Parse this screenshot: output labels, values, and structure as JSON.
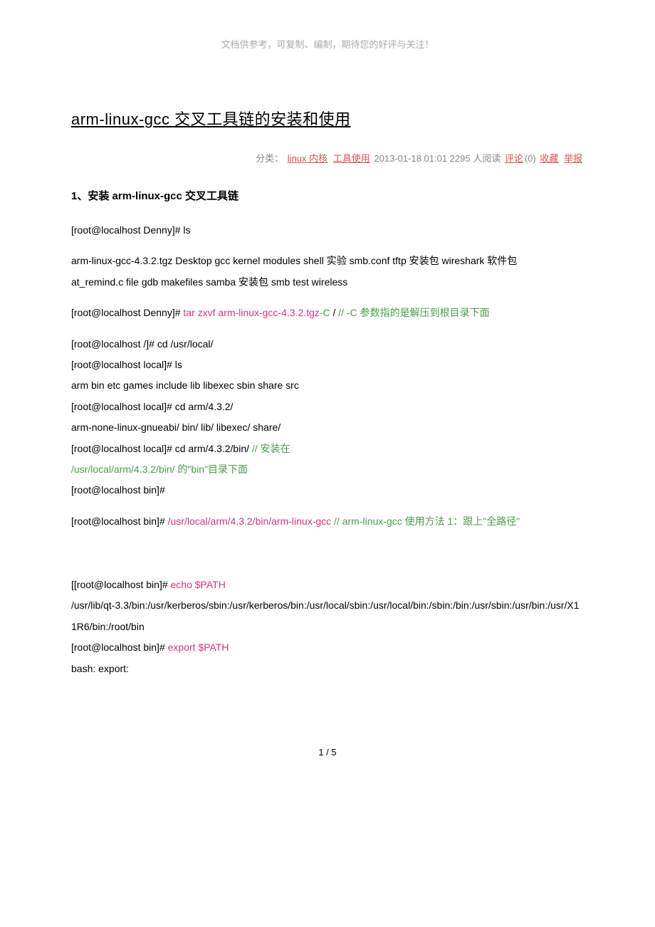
{
  "header_note": "文档供参考，可复制、编制，期待您的好评与关注！",
  "title": "arm-linux-gcc 交叉工具链的安装和使用",
  "meta": {
    "category_label": "分类：",
    "category_link1": "linux 内核",
    "category_link2": "工具使用",
    "datetime_reads": " 2013-01-18 01:01 2295 人阅读 ",
    "comments_link": "评论",
    "comments_count": "(0) ",
    "favorite_link": "收藏",
    "space": " ",
    "report_link": "举报"
  },
  "section1": "1、安装 arm-linux-gcc 交叉工具链",
  "body": {
    "l1": "[root@localhost Denny]# ls",
    "l2": "arm-linux-gcc-4.3.2.tgz  Desktop  gcc  kernel      modules       shell 实验   smb.conf  tftp 安装包   wireshark 软件包",
    "l3": "at_remind.c               file      gdb  makefiles  samba 安装包   smb        test       wireless",
    "l4_pre": "[root@localhost Denny]# ",
    "l4_cmd": "tar zxvf arm-linux-gcc-4.3.2.tgz",
    "l4_arg": "-C",
    "l4_slash": " /            ",
    "l4_comment": "// -C 参数指的是解压到根目录下面",
    "l5": "[root@localhost /]# cd /usr/local/",
    "l6": "[root@localhost local]# ls",
    "l7": "arm  bin  etc  games  include  lib  libexec  sbin  share  src",
    "l8": "[root@localhost local]# cd arm/4.3.2/",
    "l9": "arm-none-linux-gnueabi/ bin/                   lib/                   libexec/                   share/",
    "l10_pre": "[root@localhost local]# cd arm/4.3.2/bin/                                      ",
    "l10_comment_a": "//  安装在",
    "l10_comment_b": " /usr/local/arm/4.3.2/bin/    的\"bin\"目录下面",
    "l11": "[root@localhost bin]#",
    "l12_pre": "[root@localhost bin]# ",
    "l12_cmd": "/usr/local/arm/4.3.2/bin/arm-linux-gcc",
    "l12_space": "    ",
    "l12_comment": "// arm-linux-gcc  使用方法 1：跟上\"全路径\"",
    "l13_pre": "[[root@localhost bin]# ",
    "l13_cmd": "echo $PATH",
    "l14": "/usr/lib/qt-3.3/bin:/usr/kerberos/sbin:/usr/kerberos/bin:/usr/local/sbin:/usr/local/bin:/sbin:/bin:/usr/sbin:/usr/bin:/usr/X11R6/bin:/root/bin",
    "l15_pre": "[root@localhost bin]# ",
    "l15_cmd": "export $PATH",
    "l16": "bash: export:"
  },
  "page_number": "1 / 5"
}
